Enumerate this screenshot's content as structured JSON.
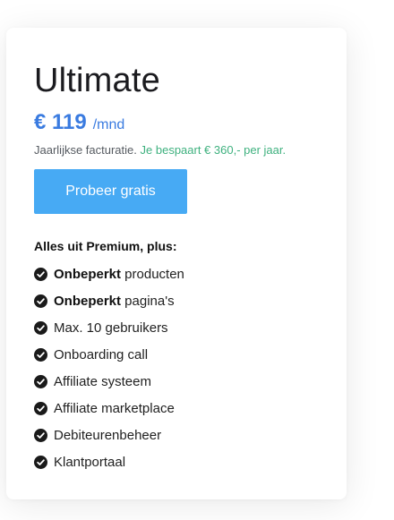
{
  "plan": {
    "name": "Ultimate",
    "price": "€ 119",
    "period": "/mnd",
    "billing_note": "Jaarlijkse facturatie.",
    "saving_note": "Je bespaart € 360,- per jaar.",
    "cta_label": "Probeer gratis"
  },
  "features": {
    "heading": "Alles uit Premium, plus:",
    "items": [
      {
        "bold": "Onbeperkt",
        "text": " producten"
      },
      {
        "bold": "Onbeperkt",
        "text": " pagina's"
      },
      {
        "bold": "",
        "text": "Max. 10 gebruikers"
      },
      {
        "bold": "",
        "text": "Onboarding call"
      },
      {
        "bold": "",
        "text": "Affiliate systeem"
      },
      {
        "bold": "",
        "text": "Affiliate marketplace"
      },
      {
        "bold": "",
        "text": "Debiteurenbeheer"
      },
      {
        "bold": "",
        "text": "Klantportaal"
      }
    ],
    "icon": "check-circle-icon"
  },
  "colors": {
    "accent": "#3a7be0",
    "button": "#47aaf4",
    "saving": "#3fb17f",
    "check": "#1a1a1a"
  }
}
